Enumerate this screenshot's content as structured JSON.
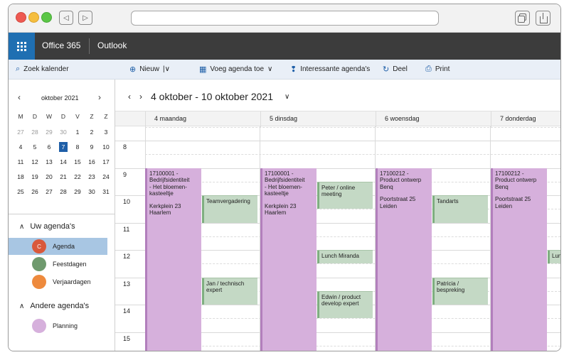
{
  "header": {
    "brand": "Office 365",
    "app": "Outlook"
  },
  "commands": {
    "search": "Zoek kalender",
    "new": "Nieuw",
    "new_caret": "|∨",
    "add_calendar": "Voeg agenda toe",
    "add_calendar_caret": "∨",
    "interesting": "Interessante agenda's",
    "share": "Deel",
    "print": "Print"
  },
  "mini_calendar": {
    "title": "oktober 2021",
    "prev": "‹",
    "next": "›",
    "day_names": [
      "M",
      "D",
      "W",
      "D",
      "V",
      "Z",
      "Z"
    ],
    "weeks": [
      [
        "27",
        "28",
        "29",
        "30",
        "1",
        "2",
        "3"
      ],
      [
        "4",
        "5",
        "6",
        "7",
        "8",
        "9",
        "10"
      ],
      [
        "11",
        "12",
        "13",
        "14",
        "15",
        "16",
        "17"
      ],
      [
        "18",
        "19",
        "20",
        "21",
        "22",
        "23",
        "24"
      ],
      [
        "25",
        "26",
        "27",
        "28",
        "29",
        "30",
        "31"
      ]
    ],
    "today": "7"
  },
  "sidebar": {
    "my_calendars_title": "Uw agenda's",
    "my_calendars": [
      {
        "label": "Agenda",
        "initial": "C",
        "color": "#d9583b",
        "selected": true
      },
      {
        "label": "Feestdagen",
        "initial": "",
        "color": "#6f9a6e",
        "selected": false
      },
      {
        "label": "Verjaardagen",
        "initial": "",
        "color": "#ee8a3d",
        "selected": false
      }
    ],
    "other_calendars_title": "Andere agenda's",
    "other_calendars": [
      {
        "label": "Planning",
        "initial": "",
        "color": "#d6b0dc",
        "selected": false
      }
    ]
  },
  "calendar": {
    "range_label": "4 oktober - 10 oktober 2021",
    "prev": "‹",
    "next": "›",
    "chevron": "∨",
    "days": [
      "4 maandag",
      "5 dinsdag",
      "6 woensdag",
      "7 donderdag"
    ],
    "hours": [
      "8",
      "9",
      "10",
      "11",
      "12",
      "13",
      "14",
      "15"
    ],
    "events": [
      {
        "title": "17100001 -\nBedrijfsidentiteit\n- Het bloemen-\nkasteeltje",
        "location": "Kerkplein 23\nHaarlem",
        "color": "purple",
        "day": 0,
        "lane": "left",
        "start": 9.0,
        "end": 16.5
      },
      {
        "title": "Teamvergadering",
        "location": "",
        "color": "green",
        "day": 0,
        "lane": "right",
        "start": 10.0,
        "end": 11.0
      },
      {
        "title": "Jan / technisch\nexpert",
        "location": "",
        "color": "green",
        "day": 0,
        "lane": "right",
        "start": 13.0,
        "end": 14.0
      },
      {
        "title": "17100001 -\nBedrijfsidentiteit\n- Het bloemen-\nkasteeltje",
        "location": "Kerkplein 23\nHaarlem",
        "color": "purple",
        "day": 1,
        "lane": "left",
        "start": 9.0,
        "end": 16.5
      },
      {
        "title": "Peter / online\nmeeting",
        "location": "",
        "color": "green",
        "day": 1,
        "lane": "right",
        "start": 9.5,
        "end": 10.5
      },
      {
        "title": "Lunch Miranda",
        "location": "",
        "color": "green",
        "day": 1,
        "lane": "right",
        "start": 12.0,
        "end": 12.5
      },
      {
        "title": "Edwin / product\ndevelop expert",
        "location": "",
        "color": "green",
        "day": 1,
        "lane": "right",
        "start": 13.5,
        "end": 14.5
      },
      {
        "title": "17100212 -\nProduct ontwerp\nBenq",
        "location": "Poortstraat 25\nLeiden",
        "color": "purple",
        "day": 2,
        "lane": "left",
        "start": 9.0,
        "end": 16.5
      },
      {
        "title": "Tandarts",
        "location": "",
        "color": "green",
        "day": 2,
        "lane": "right",
        "start": 10.0,
        "end": 11.0
      },
      {
        "title": "Patricia /\nbespreking",
        "location": "",
        "color": "green",
        "day": 2,
        "lane": "right",
        "start": 13.0,
        "end": 14.0
      },
      {
        "title": "17100212 -\nProduct ontwerp\nBenq",
        "location": "Poortstraat 25\nLeiden",
        "color": "purple",
        "day": 3,
        "lane": "left",
        "start": 9.0,
        "end": 16.5
      },
      {
        "title": "Lun",
        "location": "",
        "color": "green",
        "day": 3,
        "lane": "right",
        "start": 12.0,
        "end": 12.5
      }
    ]
  }
}
